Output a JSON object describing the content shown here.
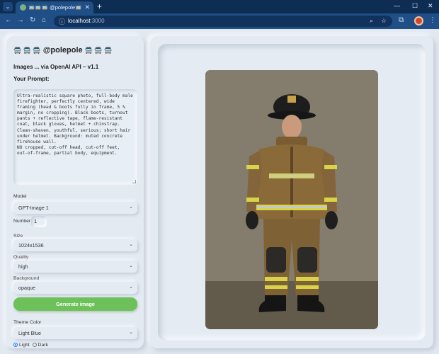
{
  "browser": {
    "tab_title": "🚍🚍🚍 @polepole🚍🚍🚍",
    "url_host": "localhost",
    "url_port": ":3000"
  },
  "sidebar": {
    "brand_cars_left": "🚍 🚍 🚍",
    "brand_name": "@polepole",
    "brand_cars_right": "🚍 🚍 🚍",
    "subtitle": "Images ... via OpenAI API – v1.1",
    "prompt_label": "Your Prompt:",
    "prompt_text": "Ultra-realistic square photo, full-body male\nfirefighter, perfectly centered, wide\nframing (head & boots fully in frame, 5 %\nmargin, no cropping). Black boots, turnout\npants + reflective tape, flame-resistant\ncoat, black gloves, helmet + chinstrap.\nClean-shaven, youthful, serious; short hair\nunder helmet. Background: muted concrete\nfirehouse wall.\nNO cropped, cut-off head, cut-off feet,\nout-of-frame, partial body, equipment.",
    "model_label": "Model",
    "model_value": "GPT-Image 1",
    "number_label": "Number",
    "number_value": "1",
    "size_label": "Size",
    "size_value": "1024x1536",
    "quality_label": "Quality",
    "quality_value": "high",
    "background_label": "Background",
    "background_value": "opaque",
    "generate_label": "Generate image",
    "theme_label": "Theme Color",
    "theme_value": "Light Blue",
    "mode_light": "Light",
    "mode_dark": "Dark",
    "mode_selected": "Light"
  },
  "main": {
    "image_subject": "firefighter-photo"
  },
  "colors": {
    "accent_green": "#6dc15a",
    "chrome_blue": "#1f4f86",
    "panel_bg": "#e3eaf2"
  }
}
